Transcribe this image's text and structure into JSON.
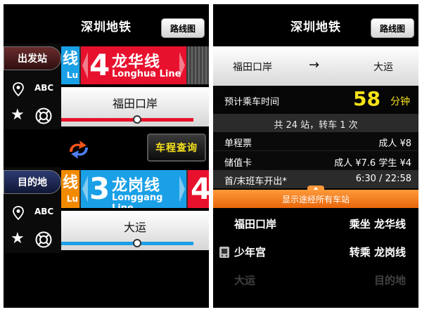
{
  "app_title": "深圳地铁",
  "map_button": "路线图",
  "left": {
    "origin": {
      "label": "出发站",
      "abc": "ABC",
      "prev_line_sub": "Lu",
      "line_number": "4",
      "line_name_zh": "龙华线",
      "line_name_en": "Longhua Line",
      "line_color": "#e8112d",
      "prev_line_color": "#1aa0e6",
      "station": "福田口岸"
    },
    "destination": {
      "label": "目的地",
      "abc": "ABC",
      "prev_line_sub": "Lu",
      "line_number": "3",
      "line_name_zh": "龙岗线",
      "line_name_en": "Longgang Line",
      "line_color": "#1aa0e6",
      "prev_line_color": "#f28a00",
      "next_line_number": "4",
      "next_line_color": "#e8112d",
      "station": "大运"
    },
    "query_button": "车程查询"
  },
  "right": {
    "route": {
      "from": "福田口岸",
      "arrow": "→",
      "to": "大运"
    },
    "time": {
      "label": "预计乘车时间",
      "value": "58",
      "unit": "分钟"
    },
    "summary": "共 24 站，转车 1 次",
    "single_ticket": {
      "label": "单程票",
      "value": "成人 ¥8"
    },
    "stored_card": {
      "label": "储值卡",
      "value": "成人 ¥7.6 学生 ¥4"
    },
    "first_last": {
      "label": "首/末班车开出*",
      "value": "6:30 / 22:58"
    },
    "show_all": "显示途经所有车站",
    "stops": [
      {
        "name": "福田口岸",
        "action": "乘坐 龙华线"
      },
      {
        "name": "少年宫",
        "action": "转乘 龙岗线"
      },
      {
        "name": "大运",
        "action": "目的地"
      }
    ]
  },
  "colors": {
    "accent_yellow": "#f5e21a",
    "orange": "#e8660a"
  },
  "icons": [
    "pin-icon",
    "star-icon",
    "lifebuoy-icon",
    "swap-icon",
    "metro-icon"
  ]
}
